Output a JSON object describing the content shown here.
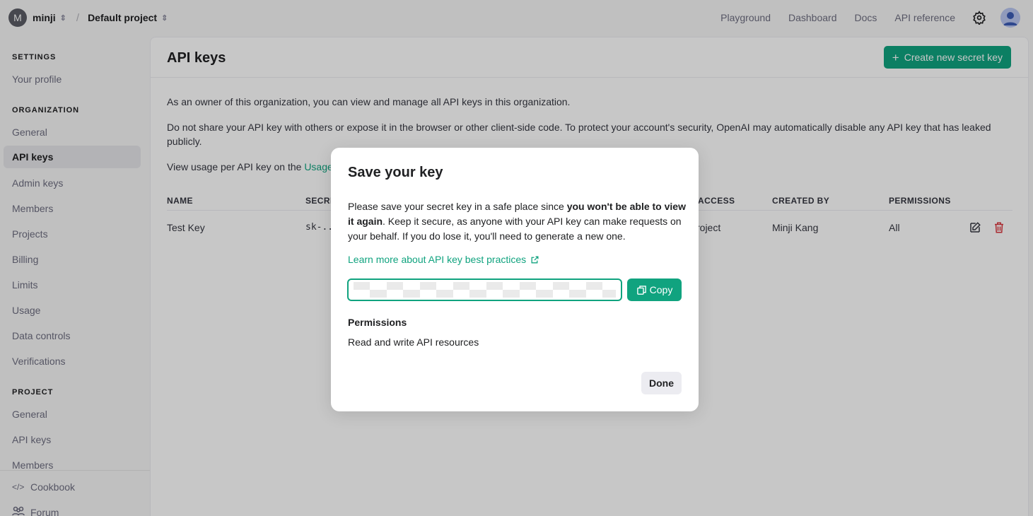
{
  "topbar": {
    "org_initial": "M",
    "org_name": "minji",
    "separator": "/",
    "project_name": "Default project",
    "nav": [
      "Playground",
      "Dashboard",
      "Docs",
      "API reference"
    ]
  },
  "sidebar": {
    "settings_header": "SETTINGS",
    "settings_items": [
      "Your profile"
    ],
    "org_header": "ORGANIZATION",
    "org_items": [
      "General",
      "API keys",
      "Admin keys",
      "Members",
      "Projects",
      "Billing",
      "Limits",
      "Usage",
      "Data controls",
      "Verifications"
    ],
    "active_item": "API keys",
    "project_header": "PROJECT",
    "project_items": [
      "General",
      "API keys",
      "Members"
    ],
    "footer": [
      "Cookbook",
      "Forum"
    ]
  },
  "main": {
    "title": "API keys",
    "create_button": "Create new secret key",
    "para1": "As an owner of this organization, you can view and manage all API keys in this organization.",
    "para2": "Do not share your API key with others or expose it in the browser or other client-side code. To protect your account's security, OpenAI may automatically disable any API key that has leaked publicly.",
    "para3_prefix": "View usage per API key on the",
    "para3_link": "Usage",
    "table": {
      "headers": [
        "NAME",
        "SECRE",
        "ACCESS",
        "CREATED BY",
        "PERMISSIONS"
      ],
      "rows": [
        {
          "name": "Test Key",
          "secret": "sk-..",
          "access": "roject",
          "created_by": "Minji Kang",
          "permissions": "All"
        }
      ]
    }
  },
  "modal": {
    "title": "Save your key",
    "text_before_bold": "Please save your secret key in a safe place since ",
    "text_bold": "you won't be able to view it again",
    "text_after_bold": ". Keep it secure, as anyone with your API key can make requests on your behalf. If you do lose it, you'll need to generate a new one.",
    "learn_more": "Learn more about API key best practices",
    "copy_button": "Copy",
    "permissions_label": "Permissions",
    "permissions_value": "Read and write API resources",
    "done_button": "Done"
  },
  "colors": {
    "accent": "#10a37f",
    "delete": "#d9363e"
  }
}
